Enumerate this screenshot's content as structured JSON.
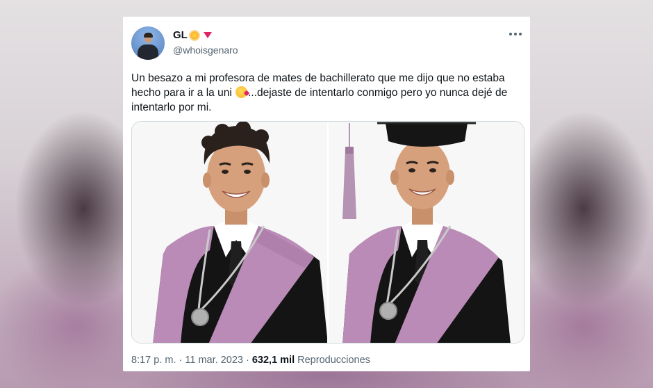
{
  "tweet": {
    "display_name": "GL",
    "handle": "@whoisgenaro",
    "text_part1": "Un besazo a mi profesora de mates de bachillerato que me dijo que no estaba hecho para ir a la uni ",
    "text_part2": "...dejaste de intentarlo conmigo pero yo nunca dejé de intentarlo por mi.",
    "time": "8:17 p. m.",
    "separator": " · ",
    "date": "11 mar. 2023",
    "views_count": "632,1 mil",
    "views_label": "Reproducciones"
  },
  "icons": {
    "verified_badge": "sun-icon",
    "affiliation": "heart-icon",
    "more": "more-icon",
    "emoji": "face-blowing-kiss-icon"
  },
  "colors": {
    "text_primary": "#0f1419",
    "text_secondary": "#536471",
    "stole": "#b98bb6",
    "gown": "#141414"
  }
}
